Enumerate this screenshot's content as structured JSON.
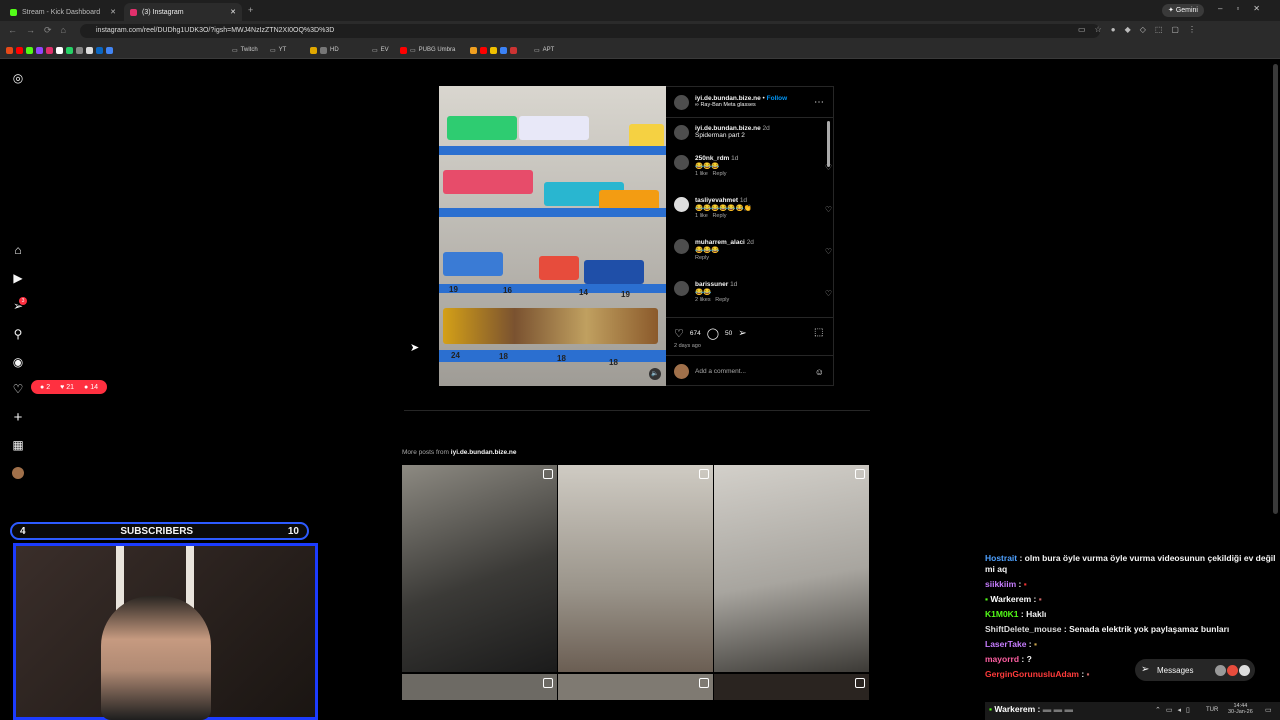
{
  "browser": {
    "tabs": [
      {
        "label": "Stream - Kick Dashboard",
        "color": "#53fc18"
      },
      {
        "label": "(3) Instagram",
        "color": "#e1306c"
      }
    ],
    "url": "instagram.com/reel/DUDhg1UDK3O/?igsh=MWJ4NzIzZTN2XI0OQ%3D%3D",
    "gemini_label": "Gemini",
    "bookmarks": [
      "Twitch",
      "YT",
      "HD",
      "EV",
      "PUBG Umbra",
      "APT"
    ]
  },
  "sidebar": {
    "notifications": {
      "comments": "2",
      "likes": "21",
      "follows": "14"
    },
    "messages_badge": "3"
  },
  "post": {
    "author": "iyi.de.bundan.bize.ne",
    "follow_label": "Follow",
    "subtitle": "Ray-Ban Meta glasses",
    "caption_user": "iyi.de.bundan.bize.ne",
    "caption_time": "2d",
    "caption_text": "Spiderman part 2",
    "comments": [
      {
        "user": "250nk_rdm",
        "time": "1d",
        "text": "😂😂😂",
        "meta": "1 like",
        "reply": "Reply"
      },
      {
        "user": "tasliyevahmet",
        "time": "1d",
        "text": "😂😂😂😂😂😂👏",
        "meta": "1 like",
        "reply": "Reply"
      },
      {
        "user": "muharrem_alaci",
        "time": "2d",
        "text": "😂😂😂",
        "meta": "",
        "reply": "Reply"
      },
      {
        "user": "barissuner",
        "time": "1d",
        "text": "😂😂",
        "meta": "2 likes",
        "reply": "Reply"
      }
    ],
    "likes": "674",
    "comment_count": "50",
    "posted": "2 days ago",
    "add_comment_placeholder": "Add a comment...",
    "price_tags": [
      "24",
      "18",
      "18",
      "18",
      "19",
      "16",
      "14",
      "19"
    ]
  },
  "more_posts": {
    "prefix": "More posts from",
    "user": "iyi.de.bundan.bize.ne"
  },
  "overlay": {
    "sub_left": "4",
    "sub_label": "SUBSCRIBERS",
    "sub_right": "10",
    "messages_label": "Messages"
  },
  "chat": [
    {
      "user": "Hostrait",
      "color": "#4ea1ff",
      "msg": " : olm bura öyle vurma öyle vurma videosunun çekildiği ev değil mi aq"
    },
    {
      "user": "siikkiim",
      "color": "#c77dff",
      "msg": " : "
    },
    {
      "user": "Warkerem",
      "color": "#ffffff",
      "msg": " : "
    },
    {
      "user": "K1M0K1",
      "color": "#53fc18",
      "msg": " : Haklı"
    },
    {
      "user": "ShiftDelete_mouse",
      "color": "#dddddd",
      "msg": " : Senada elektrik yok paylaşamaz bunları"
    },
    {
      "user": "LaserTake",
      "color": "#c77dff",
      "msg": " : "
    },
    {
      "user": "mayorrd",
      "color": "#ff5fa2",
      "msg": " : ?"
    },
    {
      "user": "GerginGorunusluAdam",
      "color": "#ff3b3b",
      "msg": " : "
    },
    {
      "user": "Warkerem",
      "color": "#ffffff",
      "msg": " : "
    }
  ],
  "taskbar": {
    "lang": "TUR",
    "time": "14:44",
    "date": "30-Jan-26"
  }
}
